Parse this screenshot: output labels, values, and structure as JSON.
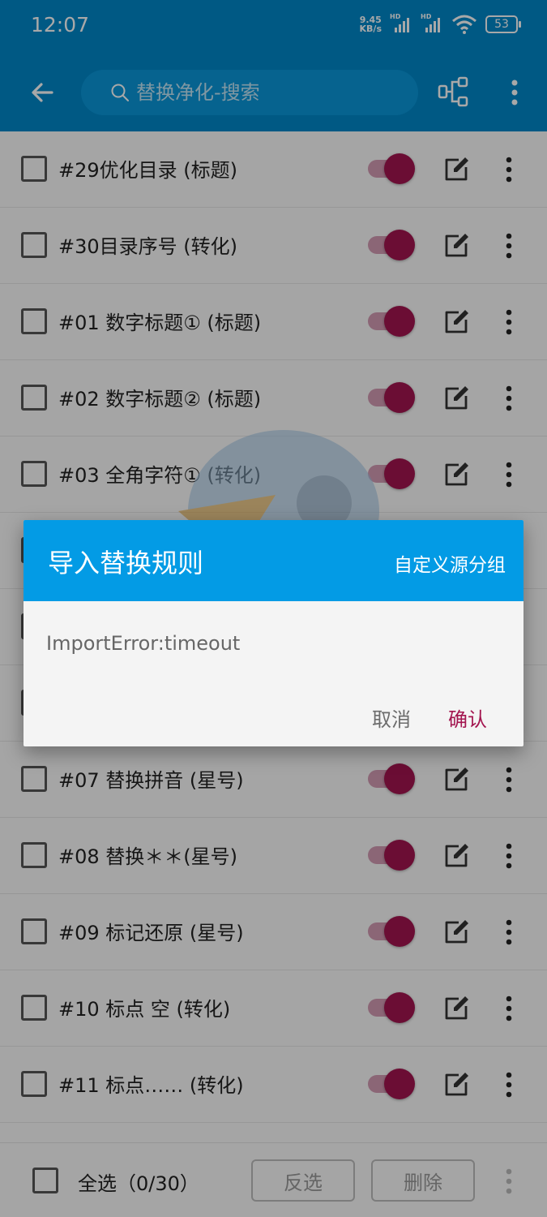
{
  "status_bar": {
    "time": "12:07",
    "net_speed_value": "9.45",
    "net_speed_unit": "KB/s",
    "sim1": "HD",
    "sim2": "HD",
    "battery": "53"
  },
  "toolbar": {
    "search_placeholder": "替换净化-搜索"
  },
  "rules": [
    {
      "label": "#29优化目录 (标题)",
      "enabled": true
    },
    {
      "label": "#30目录序号 (转化)",
      "enabled": true
    },
    {
      "label": "#01 数字标题① (标题)",
      "enabled": true
    },
    {
      "label": "#02 数字标题② (标题)",
      "enabled": true
    },
    {
      "label": "#03 全角字符① (转化)",
      "enabled": true
    },
    {
      "label": "",
      "enabled": true
    },
    {
      "label": "",
      "enabled": true
    },
    {
      "label": "",
      "enabled": true
    },
    {
      "label": "#07 替换拼音 (星号)",
      "enabled": true
    },
    {
      "label": "#08 替换＊＊(星号)",
      "enabled": true
    },
    {
      "label": "#09 标记还原 (星号)",
      "enabled": true
    },
    {
      "label": "#10 标点 空 (转化)",
      "enabled": true
    },
    {
      "label": "#11 标点…… (转化)",
      "enabled": true
    }
  ],
  "bottom_bar": {
    "select_all": "全选（0/30）",
    "invert": "反选",
    "delete": "删除"
  },
  "dialog": {
    "title": "导入替换规则",
    "custom_group": "自定义源分组",
    "message": "ImportError:timeout",
    "cancel": "取消",
    "confirm": "确认"
  },
  "colors": {
    "primary": "#0087c9",
    "dialog_header": "#039be5",
    "accent": "#a3154f"
  },
  "icons": {
    "back": "arrow-left-icon",
    "search": "search-icon",
    "group": "group-icon",
    "more": "more-vertical-icon",
    "edit": "edit-icon"
  }
}
